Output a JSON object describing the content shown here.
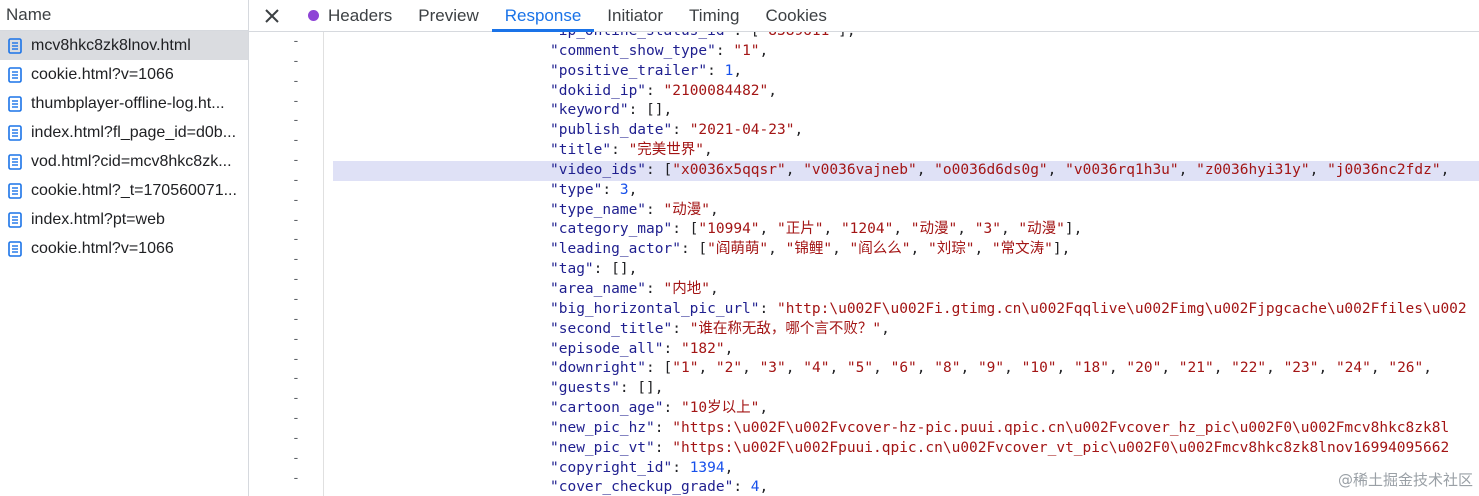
{
  "left_panel": {
    "header": "Name",
    "files": [
      {
        "name": "mcv8hkc8zk8lnov.html",
        "selected": true
      },
      {
        "name": "cookie.html?v=1066",
        "selected": false
      },
      {
        "name": "thumbplayer-offline-log.ht...",
        "selected": false
      },
      {
        "name": "index.html?fl_page_id=d0b...",
        "selected": false
      },
      {
        "name": "vod.html?cid=mcv8hkc8zk...",
        "selected": false
      },
      {
        "name": "cookie.html?_t=170560071...",
        "selected": false
      },
      {
        "name": "index.html?pt=web",
        "selected": false
      },
      {
        "name": "cookie.html?v=1066",
        "selected": false
      }
    ]
  },
  "tabs": {
    "close_icon": "close-icon",
    "items": [
      {
        "label": "Headers",
        "active": false,
        "dot": true
      },
      {
        "label": "Preview",
        "active": false
      },
      {
        "label": "Response",
        "active": true
      },
      {
        "label": "Initiator",
        "active": false
      },
      {
        "label": "Timing",
        "active": false
      },
      {
        "label": "Cookies",
        "active": false
      }
    ]
  },
  "colors": {
    "accent": "#1a73e8",
    "json_key": "#1f1f8f",
    "json_string": "#a31515",
    "json_number": "#1750eb",
    "highlight": "#dfe1f6"
  },
  "code": {
    "gutter_marker": "-",
    "highlighted_line": 7,
    "lines": [
      [
        [
          "k",
          "\"ip_online_status_id\""
        ],
        [
          "p",
          ": ["
        ],
        [
          "s",
          "\"8389611\""
        ],
        [
          "p",
          "],"
        ]
      ],
      [
        [
          "k",
          "\"comment_show_type\""
        ],
        [
          "p",
          ": "
        ],
        [
          "s",
          "\"1\""
        ],
        [
          "p",
          ","
        ]
      ],
      [
        [
          "k",
          "\"positive_trailer\""
        ],
        [
          "p",
          ": "
        ],
        [
          "n",
          "1"
        ],
        [
          "p",
          ","
        ]
      ],
      [
        [
          "k",
          "\"dokiid_ip\""
        ],
        [
          "p",
          ": "
        ],
        [
          "s",
          "\"2100084482\""
        ],
        [
          "p",
          ","
        ]
      ],
      [
        [
          "k",
          "\"keyword\""
        ],
        [
          "p",
          ": [],"
        ]
      ],
      [
        [
          "k",
          "\"publish_date\""
        ],
        [
          "p",
          ": "
        ],
        [
          "s",
          "\"2021-04-23\""
        ],
        [
          "p",
          ","
        ]
      ],
      [
        [
          "k",
          "\"title\""
        ],
        [
          "p",
          ": "
        ],
        [
          "s",
          "\"完美世界\""
        ],
        [
          "p",
          ","
        ]
      ],
      [
        [
          "k",
          "\"video_ids\""
        ],
        [
          "p",
          ": ["
        ],
        [
          "s",
          "\"x0036x5qqsr\""
        ],
        [
          "p",
          ", "
        ],
        [
          "s",
          "\"v0036vajneb\""
        ],
        [
          "p",
          ", "
        ],
        [
          "s",
          "\"o0036d6ds0g\""
        ],
        [
          "p",
          ", "
        ],
        [
          "s",
          "\"v0036rq1h3u\""
        ],
        [
          "p",
          ", "
        ],
        [
          "s",
          "\"z0036hyi31y\""
        ],
        [
          "p",
          ", "
        ],
        [
          "s",
          "\"j0036nc2fdz\""
        ],
        [
          "p",
          ","
        ]
      ],
      [
        [
          "k",
          "\"type\""
        ],
        [
          "p",
          ": "
        ],
        [
          "n",
          "3"
        ],
        [
          "p",
          ","
        ]
      ],
      [
        [
          "k",
          "\"type_name\""
        ],
        [
          "p",
          ": "
        ],
        [
          "s",
          "\"动漫\""
        ],
        [
          "p",
          ","
        ]
      ],
      [
        [
          "k",
          "\"category_map\""
        ],
        [
          "p",
          ": ["
        ],
        [
          "s",
          "\"10994\""
        ],
        [
          "p",
          ", "
        ],
        [
          "s",
          "\"正片\""
        ],
        [
          "p",
          ", "
        ],
        [
          "s",
          "\"1204\""
        ],
        [
          "p",
          ", "
        ],
        [
          "s",
          "\"动漫\""
        ],
        [
          "p",
          ", "
        ],
        [
          "s",
          "\"3\""
        ],
        [
          "p",
          ", "
        ],
        [
          "s",
          "\"动漫\""
        ],
        [
          "p",
          "],"
        ]
      ],
      [
        [
          "k",
          "\"leading_actor\""
        ],
        [
          "p",
          ": ["
        ],
        [
          "s",
          "\"阎萌萌\""
        ],
        [
          "p",
          ", "
        ],
        [
          "s",
          "\"锦鲤\""
        ],
        [
          "p",
          ", "
        ],
        [
          "s",
          "\"阎么么\""
        ],
        [
          "p",
          ", "
        ],
        [
          "s",
          "\"刘琮\""
        ],
        [
          "p",
          ", "
        ],
        [
          "s",
          "\"常文涛\""
        ],
        [
          "p",
          "],"
        ]
      ],
      [
        [
          "k",
          "\"tag\""
        ],
        [
          "p",
          ": [],"
        ]
      ],
      [
        [
          "k",
          "\"area_name\""
        ],
        [
          "p",
          ": "
        ],
        [
          "s",
          "\"内地\""
        ],
        [
          "p",
          ","
        ]
      ],
      [
        [
          "k",
          "\"big_horizontal_pic_url\""
        ],
        [
          "p",
          ": "
        ],
        [
          "s",
          "\"http:\\u002F\\u002Fi.gtimg.cn\\u002Fqqlive\\u002Fimg\\u002Fjpgcache\\u002Ffiles\\u002"
        ]
      ],
      [
        [
          "k",
          "\"second_title\""
        ],
        [
          "p",
          ": "
        ],
        [
          "s",
          "\"谁在称无敌，哪个言不败？\""
        ],
        [
          "p",
          ","
        ]
      ],
      [
        [
          "k",
          "\"episode_all\""
        ],
        [
          "p",
          ": "
        ],
        [
          "s",
          "\"182\""
        ],
        [
          "p",
          ","
        ]
      ],
      [
        [
          "k",
          "\"downright\""
        ],
        [
          "p",
          ": ["
        ],
        [
          "s",
          "\"1\""
        ],
        [
          "p",
          ", "
        ],
        [
          "s",
          "\"2\""
        ],
        [
          "p",
          ", "
        ],
        [
          "s",
          "\"3\""
        ],
        [
          "p",
          ", "
        ],
        [
          "s",
          "\"4\""
        ],
        [
          "p",
          ", "
        ],
        [
          "s",
          "\"5\""
        ],
        [
          "p",
          ", "
        ],
        [
          "s",
          "\"6\""
        ],
        [
          "p",
          ", "
        ],
        [
          "s",
          "\"8\""
        ],
        [
          "p",
          ", "
        ],
        [
          "s",
          "\"9\""
        ],
        [
          "p",
          ", "
        ],
        [
          "s",
          "\"10\""
        ],
        [
          "p",
          ", "
        ],
        [
          "s",
          "\"18\""
        ],
        [
          "p",
          ", "
        ],
        [
          "s",
          "\"20\""
        ],
        [
          "p",
          ", "
        ],
        [
          "s",
          "\"21\""
        ],
        [
          "p",
          ", "
        ],
        [
          "s",
          "\"22\""
        ],
        [
          "p",
          ", "
        ],
        [
          "s",
          "\"23\""
        ],
        [
          "p",
          ", "
        ],
        [
          "s",
          "\"24\""
        ],
        [
          "p",
          ", "
        ],
        [
          "s",
          "\"26\""
        ],
        [
          "p",
          ", "
        ]
      ],
      [
        [
          "k",
          "\"guests\""
        ],
        [
          "p",
          ": [],"
        ]
      ],
      [
        [
          "k",
          "\"cartoon_age\""
        ],
        [
          "p",
          ": "
        ],
        [
          "s",
          "\"10岁以上\""
        ],
        [
          "p",
          ","
        ]
      ],
      [
        [
          "k",
          "\"new_pic_hz\""
        ],
        [
          "p",
          ": "
        ],
        [
          "s",
          "\"https:\\u002F\\u002Fvcover-hz-pic.puui.qpic.cn\\u002Fvcover_hz_pic\\u002F0\\u002Fmcv8hkc8zk8l"
        ]
      ],
      [
        [
          "k",
          "\"new_pic_vt\""
        ],
        [
          "p",
          ": "
        ],
        [
          "s",
          "\"https:\\u002F\\u002Fpuui.qpic.cn\\u002Fvcover_vt_pic\\u002F0\\u002Fmcv8hkc8zk8lnov16994095662"
        ]
      ],
      [
        [
          "k",
          "\"copyright_id\""
        ],
        [
          "p",
          ": "
        ],
        [
          "n",
          "1394"
        ],
        [
          "p",
          ","
        ]
      ],
      [
        [
          "k",
          "\"cover_checkup_grade\""
        ],
        [
          "p",
          ": "
        ],
        [
          "n",
          "4"
        ],
        [
          "p",
          ","
        ]
      ]
    ]
  },
  "watermark": "@稀土掘金技术社区"
}
